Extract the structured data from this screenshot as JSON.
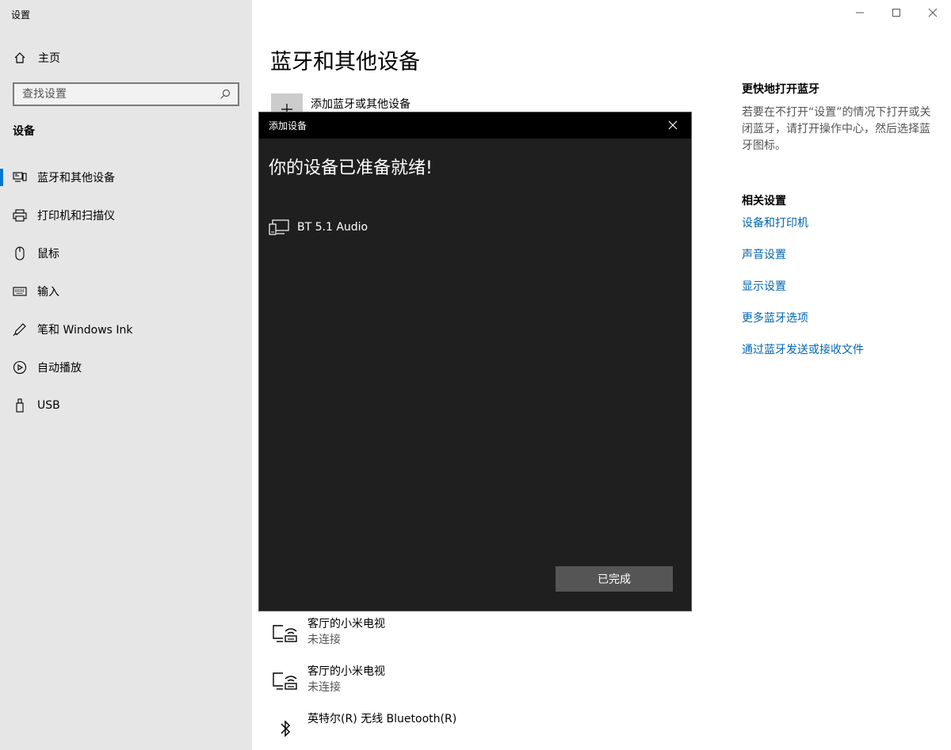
{
  "app": {
    "title": "设置"
  },
  "window_controls": {
    "minimize_icon": "minimize-icon",
    "maximize_icon": "maximize-icon",
    "close_icon": "close-icon"
  },
  "sidebar": {
    "home_label": "主页",
    "search_placeholder": "查找设置",
    "section": "设备",
    "items": [
      {
        "label": "蓝牙和其他设备",
        "icon": "bluetooth-devices-icon",
        "active": true
      },
      {
        "label": "打印机和扫描仪",
        "icon": "printer-icon",
        "active": false
      },
      {
        "label": "鼠标",
        "icon": "mouse-icon",
        "active": false
      },
      {
        "label": "输入",
        "icon": "keyboard-icon",
        "active": false
      },
      {
        "label": "笔和 Windows Ink",
        "icon": "pen-icon",
        "active": false
      },
      {
        "label": "自动播放",
        "icon": "autoplay-icon",
        "active": false
      },
      {
        "label": "USB",
        "icon": "usb-icon",
        "active": false
      }
    ]
  },
  "main": {
    "title": "蓝牙和其他设备",
    "add_device_label": "添加蓝牙或其他设备",
    "devices": [
      {
        "name": "客厅的小米电视",
        "status": "未连接",
        "icon": "tv-icon"
      },
      {
        "name": "客厅的小米电视",
        "status": "未连接",
        "icon": "tv-icon"
      },
      {
        "name": "英特尔(R) 无线 Bluetooth(R)",
        "status": "",
        "icon": "bluetooth-icon"
      }
    ]
  },
  "right": {
    "quick_heading": "更快地打开蓝牙",
    "quick_desc": "若要在不打开“设置”的情况下打开或关闭蓝牙，请打开操作中心，然后选择蓝牙图标。",
    "related_heading": "相关设置",
    "links": [
      "设备和打印机",
      "声音设置",
      "显示设置",
      "更多蓝牙选项",
      "通过蓝牙发送或接收文件"
    ]
  },
  "dialog": {
    "title": "添加设备",
    "heading": "你的设备已准备就绪!",
    "device_name": "BT 5.1 Audio",
    "done_label": "已完成"
  },
  "colors": {
    "accent": "#0078d7",
    "link": "#0066b4",
    "dialog_bg": "#1f1f1f",
    "dialog_titlebar": "#000000",
    "sidebar_bg": "#e6e6e6"
  }
}
